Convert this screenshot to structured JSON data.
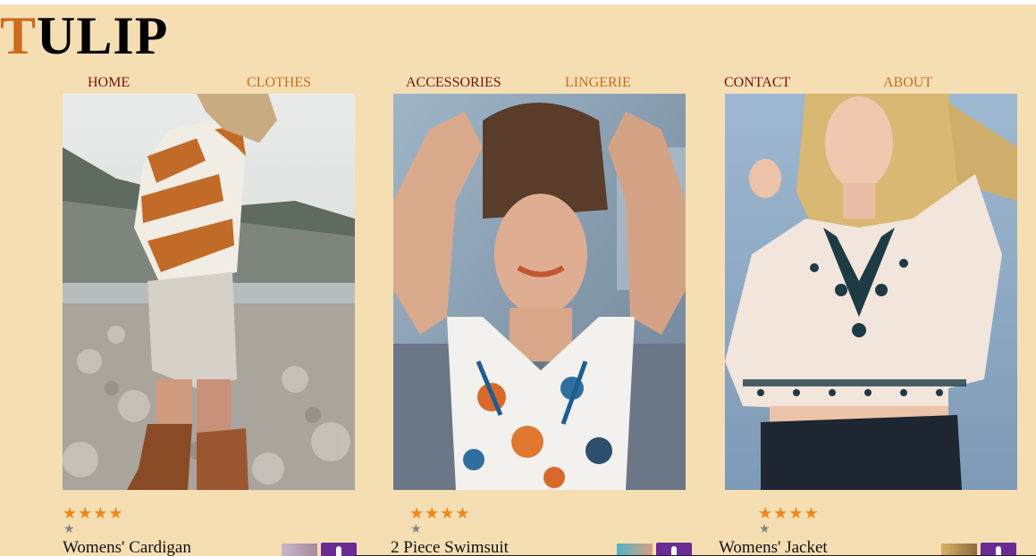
{
  "brand": {
    "first_letter": "T",
    "rest": "ULIP",
    "accent_color": "#cf6a1c"
  },
  "nav": {
    "home": "HOME",
    "clothes": "CLOTHES",
    "accessories": "ACCESSORIES",
    "lingerie": "LINGERIE",
    "contact": "CONTACT",
    "about": "ABOUT"
  },
  "products": [
    {
      "name": "Womens' Cardigan",
      "rating": 4,
      "image_icon": "model-chevron-sweater-photo",
      "thumb_icon": "thumbnail-icon",
      "cart_icon": "cart-button-icon"
    },
    {
      "name": "2 Piece Swimsuit",
      "rating": 4,
      "image_icon": "model-floral-swimsuit-photo",
      "thumb_icon": "thumbnail-icon",
      "cart_icon": "cart-button-icon"
    },
    {
      "name": "Womens' Jacket",
      "rating": 4,
      "image_icon": "model-embroidered-blouse-photo",
      "thumb_icon": "thumbnail-icon",
      "cart_icon": "cart-button-icon"
    }
  ],
  "colors": {
    "background": "#f6deb3",
    "nav_dark": "#7a1310",
    "nav_orange": "#c76f22",
    "star": "#f1861a",
    "star_empty": "#858585",
    "cart_button": "#6b2b95"
  }
}
